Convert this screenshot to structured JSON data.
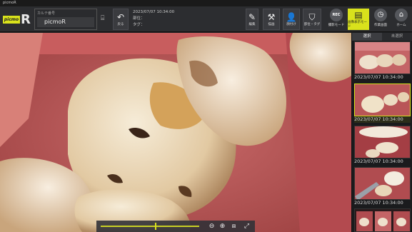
{
  "window": {
    "title": "picmoR"
  },
  "logo": {
    "badge": "picmo",
    "letter": "R"
  },
  "patient": {
    "label": "カルテ番号",
    "name": "picmoR"
  },
  "buttons": {
    "back": "戻る",
    "edit": "編集",
    "tools": "描画",
    "register": "顔付け",
    "tag": "部位・タグ",
    "rec": "撮影モード",
    "rec_badge": "REC",
    "image_mode": "画像表示モード",
    "video": "作業画面",
    "home": "ホーム"
  },
  "info": {
    "datetime": "2023/07/07 10:34:00",
    "site": "部位：",
    "tag": "タグ："
  },
  "sidebar": {
    "tabs": [
      "選択",
      "未選択"
    ],
    "thumbnails": [
      {
        "caption": "2023/07/07 10:34:00",
        "selected": false
      },
      {
        "caption": "2023/07/07 10:34:00",
        "selected": true
      },
      {
        "caption": "2023/07/07 10:34:00",
        "selected": false
      },
      {
        "caption": "2023/07/07 10:34:00",
        "selected": false
      }
    ]
  },
  "viewer": {
    "zoom_slider_level": 0.55
  },
  "colors": {
    "accent": "#d9e21c",
    "toolbar": "#2c2d30"
  }
}
